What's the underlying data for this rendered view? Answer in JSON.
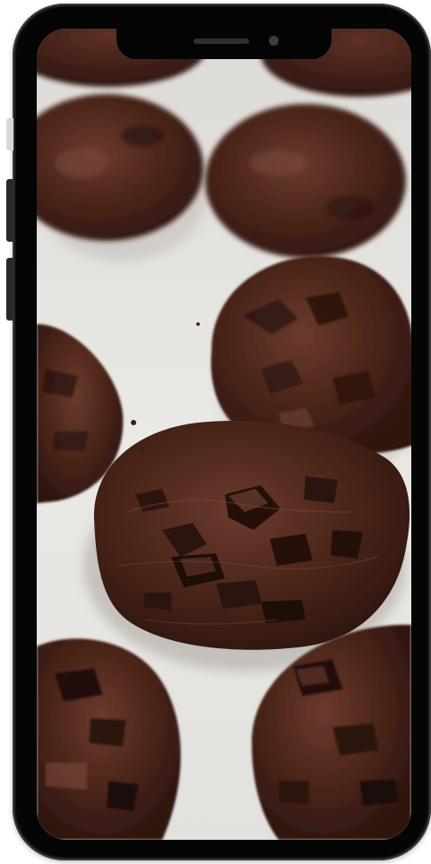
{
  "device": {
    "type": "smartphone mockup",
    "frame_color": "#141414",
    "screen_background": "#e8e6e2"
  },
  "screen": {
    "content": "photo",
    "subject_icon": "cookie-photo",
    "colors": {
      "paper": "#e8e6e2",
      "cookie_dark": "#3b1f18",
      "cookie_mid": "#5a3026",
      "chocolate_chunk": "#2a140f",
      "highlight": "#7a4a3c"
    }
  }
}
